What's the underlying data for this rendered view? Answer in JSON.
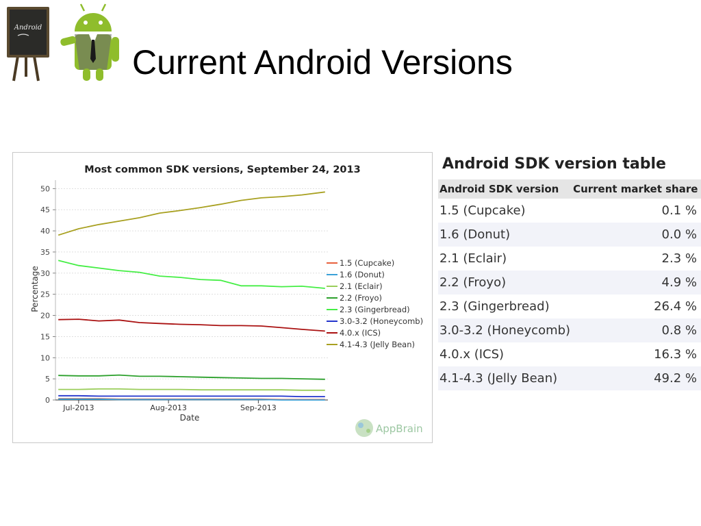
{
  "slide": {
    "title": "Current Android Versions"
  },
  "logo": {
    "board_text": "Android"
  },
  "chart_data": {
    "type": "line",
    "title": "Most common SDK versions, September 24, 2013",
    "xlabel": "Date",
    "ylabel": "Percentage",
    "ylim": [
      0,
      52
    ],
    "yticks": [
      0,
      5,
      10,
      15,
      20,
      25,
      30,
      35,
      40,
      45,
      50
    ],
    "x_ticks": [
      "Jul-2013",
      "Aug-2013",
      "Sep-2013"
    ],
    "x": [
      "2013-06-24",
      "2013-07-01",
      "2013-07-08",
      "2013-07-15",
      "2013-07-22",
      "2013-07-29",
      "2013-08-05",
      "2013-08-12",
      "2013-08-19",
      "2013-08-26",
      "2013-09-02",
      "2013-09-09",
      "2013-09-16",
      "2013-09-24"
    ],
    "grid": true,
    "legend_position": "right",
    "watermark": "AppBrain",
    "series": [
      {
        "name": "1.5 (Cupcake)",
        "color": "#e8603c",
        "values": [
          0.3,
          0.3,
          0.3,
          0.2,
          0.2,
          0.2,
          0.2,
          0.2,
          0.2,
          0.2,
          0.2,
          0.1,
          0.1,
          0.1
        ]
      },
      {
        "name": "1.6 (Donut)",
        "color": "#3aa0d8",
        "values": [
          0.2,
          0.2,
          0.2,
          0.1,
          0.1,
          0.1,
          0.1,
          0.1,
          0.1,
          0.1,
          0.1,
          0.0,
          0.0,
          0.0
        ]
      },
      {
        "name": "2.1 (Eclair)",
        "color": "#9acd5a",
        "values": [
          2.5,
          2.5,
          2.6,
          2.6,
          2.5,
          2.5,
          2.5,
          2.4,
          2.4,
          2.4,
          2.4,
          2.4,
          2.3,
          2.3
        ]
      },
      {
        "name": "2.2 (Froyo)",
        "color": "#2ca02c",
        "values": [
          5.8,
          5.7,
          5.7,
          5.9,
          5.6,
          5.6,
          5.5,
          5.4,
          5.3,
          5.2,
          5.1,
          5.1,
          5.0,
          4.9
        ]
      },
      {
        "name": "2.3 (Gingerbread)",
        "color": "#44ee44",
        "values": [
          33.0,
          31.8,
          31.2,
          30.6,
          30.2,
          29.3,
          29.0,
          28.5,
          28.3,
          27.0,
          27.0,
          26.8,
          26.9,
          26.4
        ]
      },
      {
        "name": "3.0-3.2 (Honeycomb)",
        "color": "#2233cc",
        "values": [
          1.0,
          1.0,
          0.9,
          0.9,
          0.9,
          0.9,
          0.9,
          0.9,
          0.9,
          0.9,
          0.9,
          0.9,
          0.8,
          0.8
        ]
      },
      {
        "name": "4.0.x (ICS)",
        "color": "#aa1111",
        "values": [
          19.0,
          19.1,
          18.7,
          18.9,
          18.3,
          18.1,
          17.9,
          17.8,
          17.6,
          17.6,
          17.5,
          17.1,
          16.7,
          16.3
        ]
      },
      {
        "name": "4.1-4.3 (Jelly Bean)",
        "color": "#a8a020",
        "values": [
          39.0,
          40.5,
          41.5,
          42.3,
          43.1,
          44.2,
          44.8,
          45.5,
          46.3,
          47.2,
          47.8,
          48.1,
          48.5,
          49.2
        ]
      }
    ]
  },
  "sdk_table": {
    "title": "Android SDK version table",
    "headers": [
      "Android SDK version",
      "Current market share"
    ],
    "rows": [
      {
        "version": "1.5 (Cupcake)",
        "share": "0.1 %"
      },
      {
        "version": "1.6 (Donut)",
        "share": "0.0 %"
      },
      {
        "version": "2.1 (Eclair)",
        "share": "2.3 %"
      },
      {
        "version": "2.2 (Froyo)",
        "share": "4.9 %"
      },
      {
        "version": "2.3 (Gingerbread)",
        "share": "26.4 %"
      },
      {
        "version": "3.0-3.2 (Honeycomb)",
        "share": "0.8 %"
      },
      {
        "version": "4.0.x (ICS)",
        "share": "16.3 %"
      },
      {
        "version": "4.1-4.3 (Jelly Bean)",
        "share": "49.2 %"
      }
    ]
  }
}
